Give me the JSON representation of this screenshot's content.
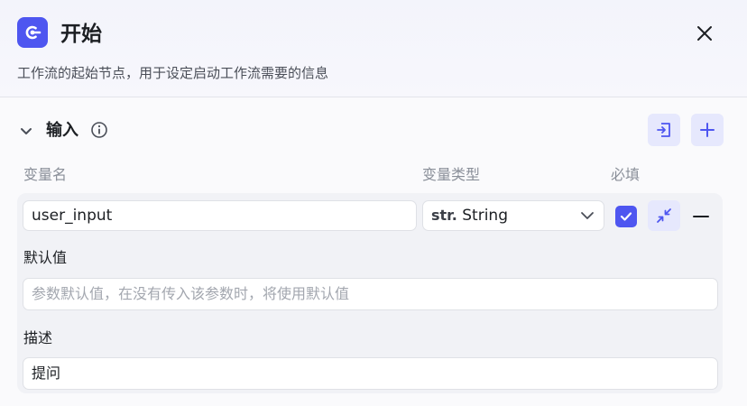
{
  "header": {
    "title": "开始",
    "description": "工作流的起始节点，用于设定启动工作流需要的信息",
    "node_icon": "start-node-icon",
    "close_icon": "close-icon"
  },
  "input_section": {
    "title": "输入",
    "info_icon": "info-icon",
    "import_icon": "import-icon",
    "add_icon": "plus-icon",
    "columns": {
      "name": "变量名",
      "type": "变量类型",
      "required": "必填"
    },
    "variable": {
      "name": "user_input",
      "type_prefix": "str.",
      "type": "String",
      "required": true,
      "default_label": "默认值",
      "default_placeholder": "参数默认值，在没有传入该参数时，将使用默认值",
      "description_label": "描述",
      "description": "提问"
    }
  },
  "colors": {
    "accent": "#4e56f0",
    "accent_light": "#e6e8fd"
  }
}
